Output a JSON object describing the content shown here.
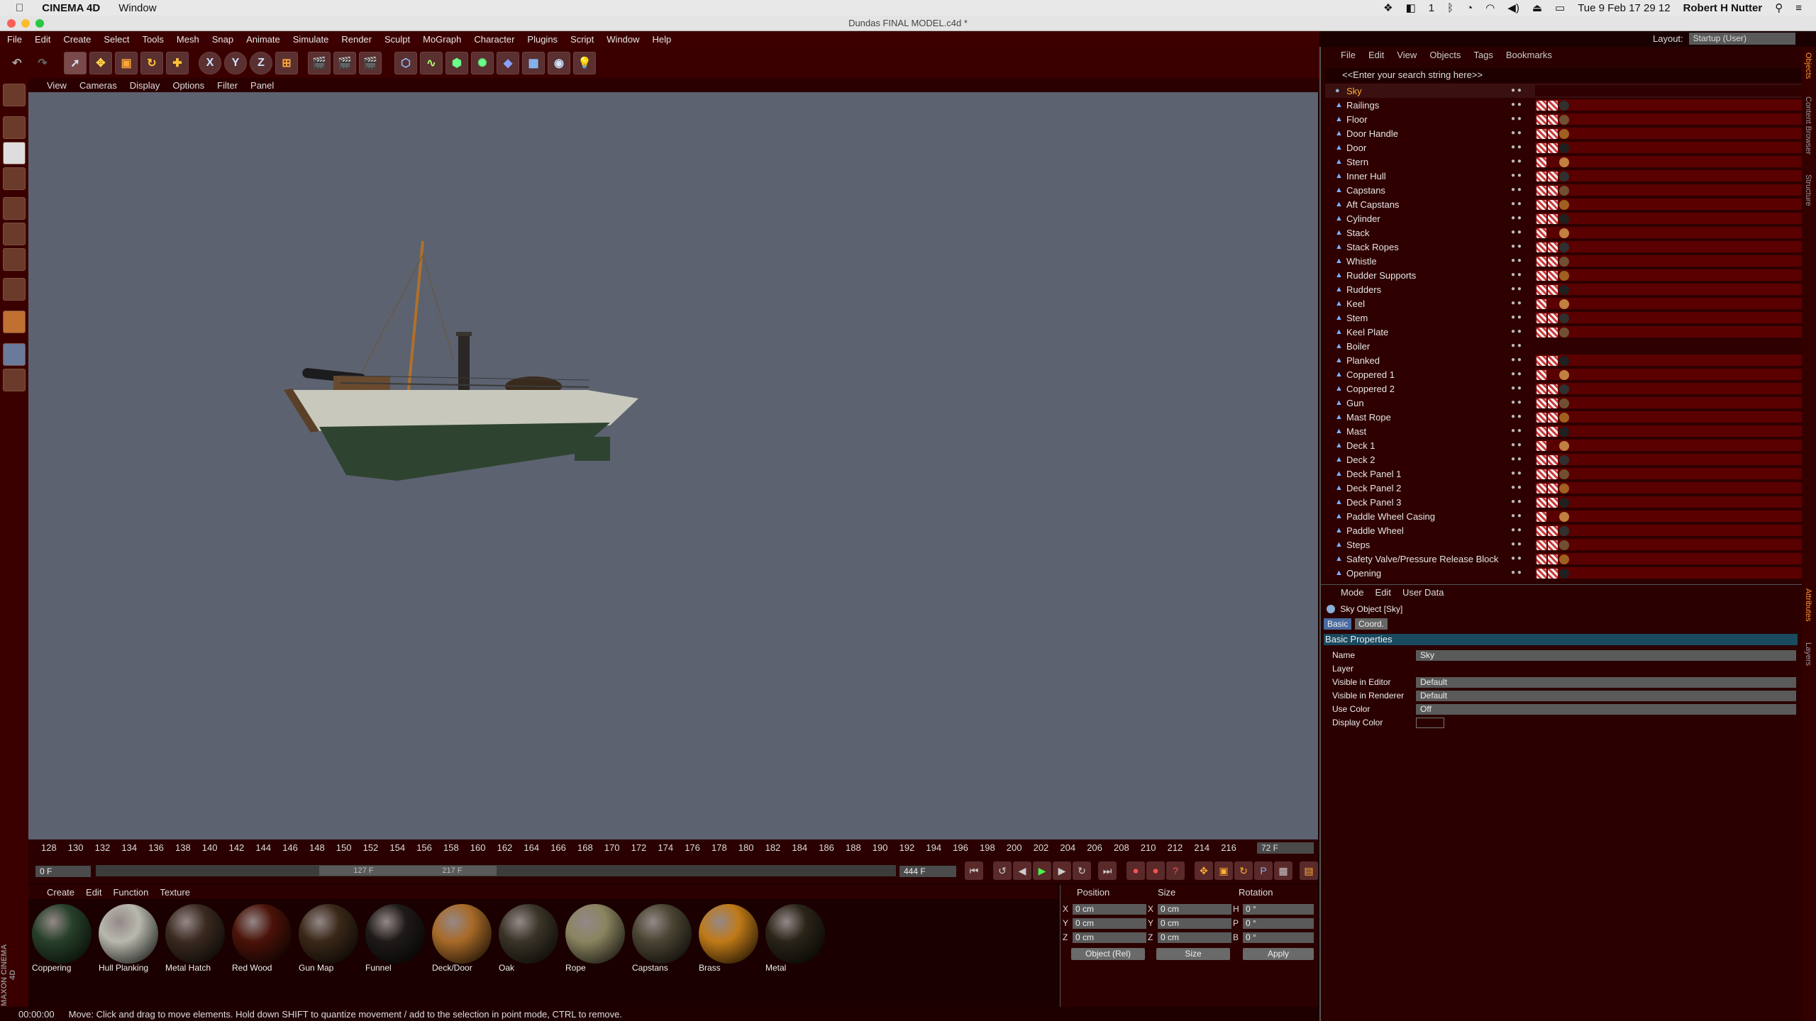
{
  "mac_menubar": {
    "app_name": "CINEMA 4D",
    "window_menu": "Window",
    "datetime": "Tue 9 Feb  17 29 12",
    "user": "Robert H Nutter",
    "badge_count": "1"
  },
  "window_title": "Dundas FINAL MODEL.c4d *",
  "main_menu": [
    "File",
    "Edit",
    "Create",
    "Select",
    "Tools",
    "Mesh",
    "Snap",
    "Animate",
    "Simulate",
    "Render",
    "Sculpt",
    "MoGraph",
    "Character",
    "Plugins",
    "Script",
    "Window",
    "Help"
  ],
  "layout": {
    "label": "Layout:",
    "value": "Startup (User)"
  },
  "axis_buttons": [
    "X",
    "Y",
    "Z"
  ],
  "viewport_menu": [
    "View",
    "Cameras",
    "Display",
    "Options",
    "Filter",
    "Panel"
  ],
  "timeline": {
    "ticks": [
      "128",
      "130",
      "132",
      "134",
      "136",
      "138",
      "140",
      "142",
      "144",
      "146",
      "148",
      "150",
      "152",
      "154",
      "156",
      "158",
      "160",
      "162",
      "164",
      "166",
      "168",
      "170",
      "172",
      "174",
      "176",
      "178",
      "180",
      "182",
      "184",
      "186",
      "188",
      "190",
      "192",
      "194",
      "196",
      "198",
      "200",
      "202",
      "204",
      "206",
      "208",
      "210",
      "212",
      "214",
      "216"
    ],
    "current_frame": "72 F",
    "start_field": "0 F",
    "range_start": "127 F",
    "range_end": "217 F",
    "end_field": "444 F"
  },
  "material_menu": [
    "Create",
    "Edit",
    "Function",
    "Texture"
  ],
  "materials": [
    {
      "name": "Coppering",
      "color": "#27402a"
    },
    {
      "name": "Hull Planking",
      "color": "#b8b8ae"
    },
    {
      "name": "Metal Hatch",
      "color": "#3a2a20"
    },
    {
      "name": "Red Wood",
      "color": "#4a1208"
    },
    {
      "name": "Gun Map",
      "color": "#3a2818"
    },
    {
      "name": "Funnel",
      "color": "#1e1a18"
    },
    {
      "name": "Deck/Door",
      "color": "#a86a28"
    },
    {
      "name": "Oak",
      "color": "#3a3428"
    },
    {
      "name": "Rope",
      "color": "#8a8460"
    },
    {
      "name": "Capstans",
      "color": "#4a4432"
    },
    {
      "name": "Brass",
      "color": "#c07a18"
    },
    {
      "name": "Metal",
      "color": "#2a2418"
    }
  ],
  "coordinates": {
    "headers": [
      "Position",
      "Size",
      "Rotation"
    ],
    "axes_pos": [
      "X",
      "Y",
      "Z"
    ],
    "axes_rot": [
      "H",
      "P",
      "B"
    ],
    "position": [
      "0 cm",
      "0 cm",
      "0 cm"
    ],
    "size": [
      "0 cm",
      "0 cm",
      "0 cm"
    ],
    "rotation": [
      "0 °",
      "0 °",
      "0 °"
    ],
    "mode_select": "Object (Rel)",
    "size_select": "Size",
    "apply": "Apply"
  },
  "status": {
    "time": "00:00:00",
    "message": "Move: Click and drag to move elements. Hold down SHIFT to quantize movement / add to the selection in point mode, CTRL to remove."
  },
  "brand": "MAXON CINEMA 4D",
  "objects_panel": {
    "menu": [
      "File",
      "Edit",
      "View",
      "Objects",
      "Tags",
      "Bookmarks"
    ],
    "search_placeholder": "<<Enter your search string here>>",
    "items": [
      "Sky",
      "Railings",
      "Floor",
      "Door Handle",
      "Door",
      "Stern",
      "Inner Hull",
      "Capstans",
      "Aft Capstans",
      "Cylinder",
      "Stack",
      "Stack Ropes",
      "Whistle",
      "Rudder Supports",
      "Rudders",
      "Keel",
      "Stem",
      "Keel Plate",
      "Boiler",
      "Planked",
      "Coppered 1",
      "Coppered 2",
      "Gun",
      "Mast Rope",
      "Mast",
      "Deck 1",
      "Deck 2",
      "Deck Panel 1",
      "Deck Panel 2",
      "Deck Panel 3",
      "Paddle Wheel Casing",
      "Paddle Wheel",
      "Steps",
      "Safety Valve/Pressure Release Block",
      "Opening"
    ],
    "selected": "Sky"
  },
  "attributes_panel": {
    "menu": [
      "Mode",
      "Edit",
      "User Data"
    ],
    "object_title": "Sky Object [Sky]",
    "tabs": [
      "Basic",
      "Coord."
    ],
    "section": "Basic Properties",
    "fields": [
      {
        "label": "Name",
        "value": "Sky"
      },
      {
        "label": "Layer",
        "value": ""
      },
      {
        "label": "Visible in Editor",
        "value": "Default"
      },
      {
        "label": "Visible in Renderer",
        "value": "Default"
      },
      {
        "label": "Use Color",
        "value": "Off"
      },
      {
        "label": "Display Color",
        "value": ""
      }
    ]
  },
  "side_tabs": [
    "Objects",
    "Content Browser",
    "Structure",
    "Attributes",
    "Layers"
  ]
}
